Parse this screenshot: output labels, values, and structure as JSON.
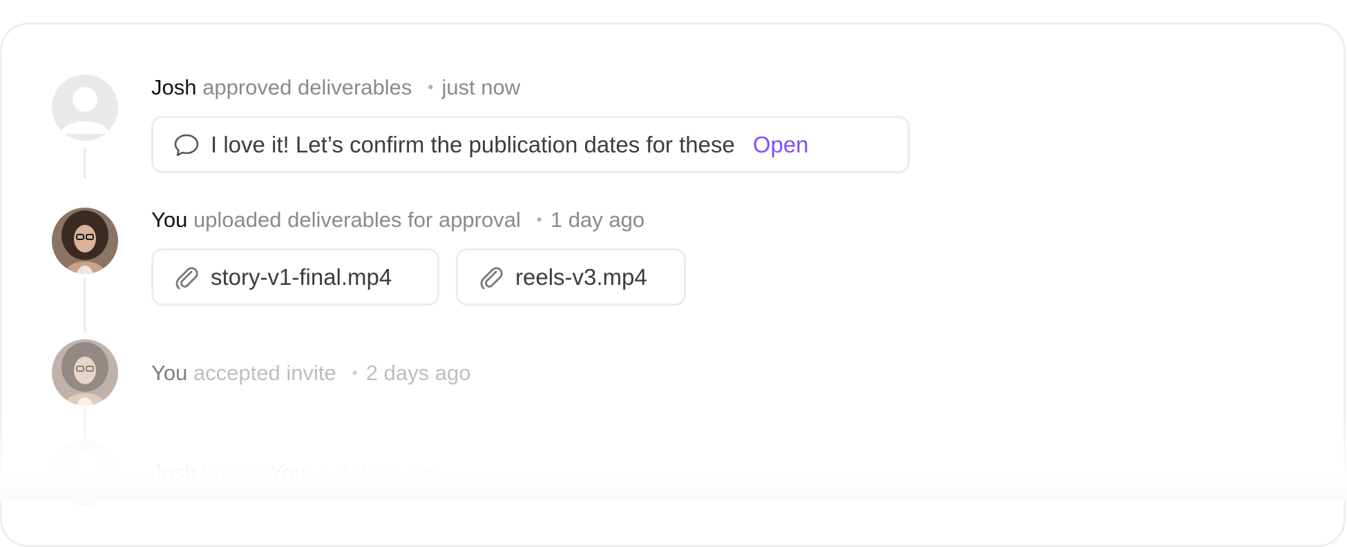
{
  "activity": {
    "items": [
      {
        "actor": "Josh",
        "action": "approved deliverables",
        "separator": "•",
        "time": "just now",
        "comment": {
          "icon": "speech-bubble-icon",
          "text": "I love it! Let’s confirm the publication dates for these",
          "link_label": "Open"
        }
      },
      {
        "actor": "You",
        "action": "uploaded deliverables for approval",
        "separator": "•",
        "time": "1 day ago",
        "attachments": [
          {
            "icon": "paperclip-icon",
            "name": "story-v1-final.mp4"
          },
          {
            "icon": "paperclip-icon",
            "name": "reels-v3.mp4"
          }
        ]
      },
      {
        "actor": "You",
        "action": "accepted invite",
        "separator": "•",
        "time": "2 days ago"
      },
      {
        "actor": "Josh",
        "action": "invited",
        "target": "You",
        "separator": "•",
        "time": "3 days ago"
      }
    ]
  },
  "colors": {
    "accent": "#7c4dff",
    "border": "#ececec",
    "muted_text": "#8a8a8a",
    "strong_text": "#111111"
  }
}
